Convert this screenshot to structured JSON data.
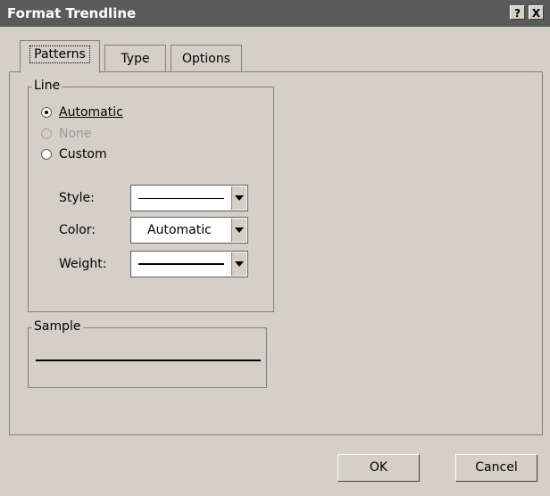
{
  "window": {
    "title": "Format Trendline",
    "help_label": "?",
    "close_label": "X"
  },
  "tabs": [
    {
      "label": "Patterns",
      "active": true
    },
    {
      "label": "Type",
      "active": false
    },
    {
      "label": "Options",
      "active": false
    }
  ],
  "line_group": {
    "label": "Line",
    "radios": [
      {
        "label": "Automatic",
        "checked": true,
        "disabled": false
      },
      {
        "label": "None",
        "checked": false,
        "disabled": true
      },
      {
        "label": "Custom",
        "checked": false,
        "disabled": false
      }
    ],
    "style_label": "Style:",
    "color_label": "Color:",
    "color_value": "Automatic",
    "weight_label": "Weight:"
  },
  "sample_group": {
    "label": "Sample"
  },
  "buttons": {
    "ok": "OK",
    "cancel": "Cancel"
  }
}
